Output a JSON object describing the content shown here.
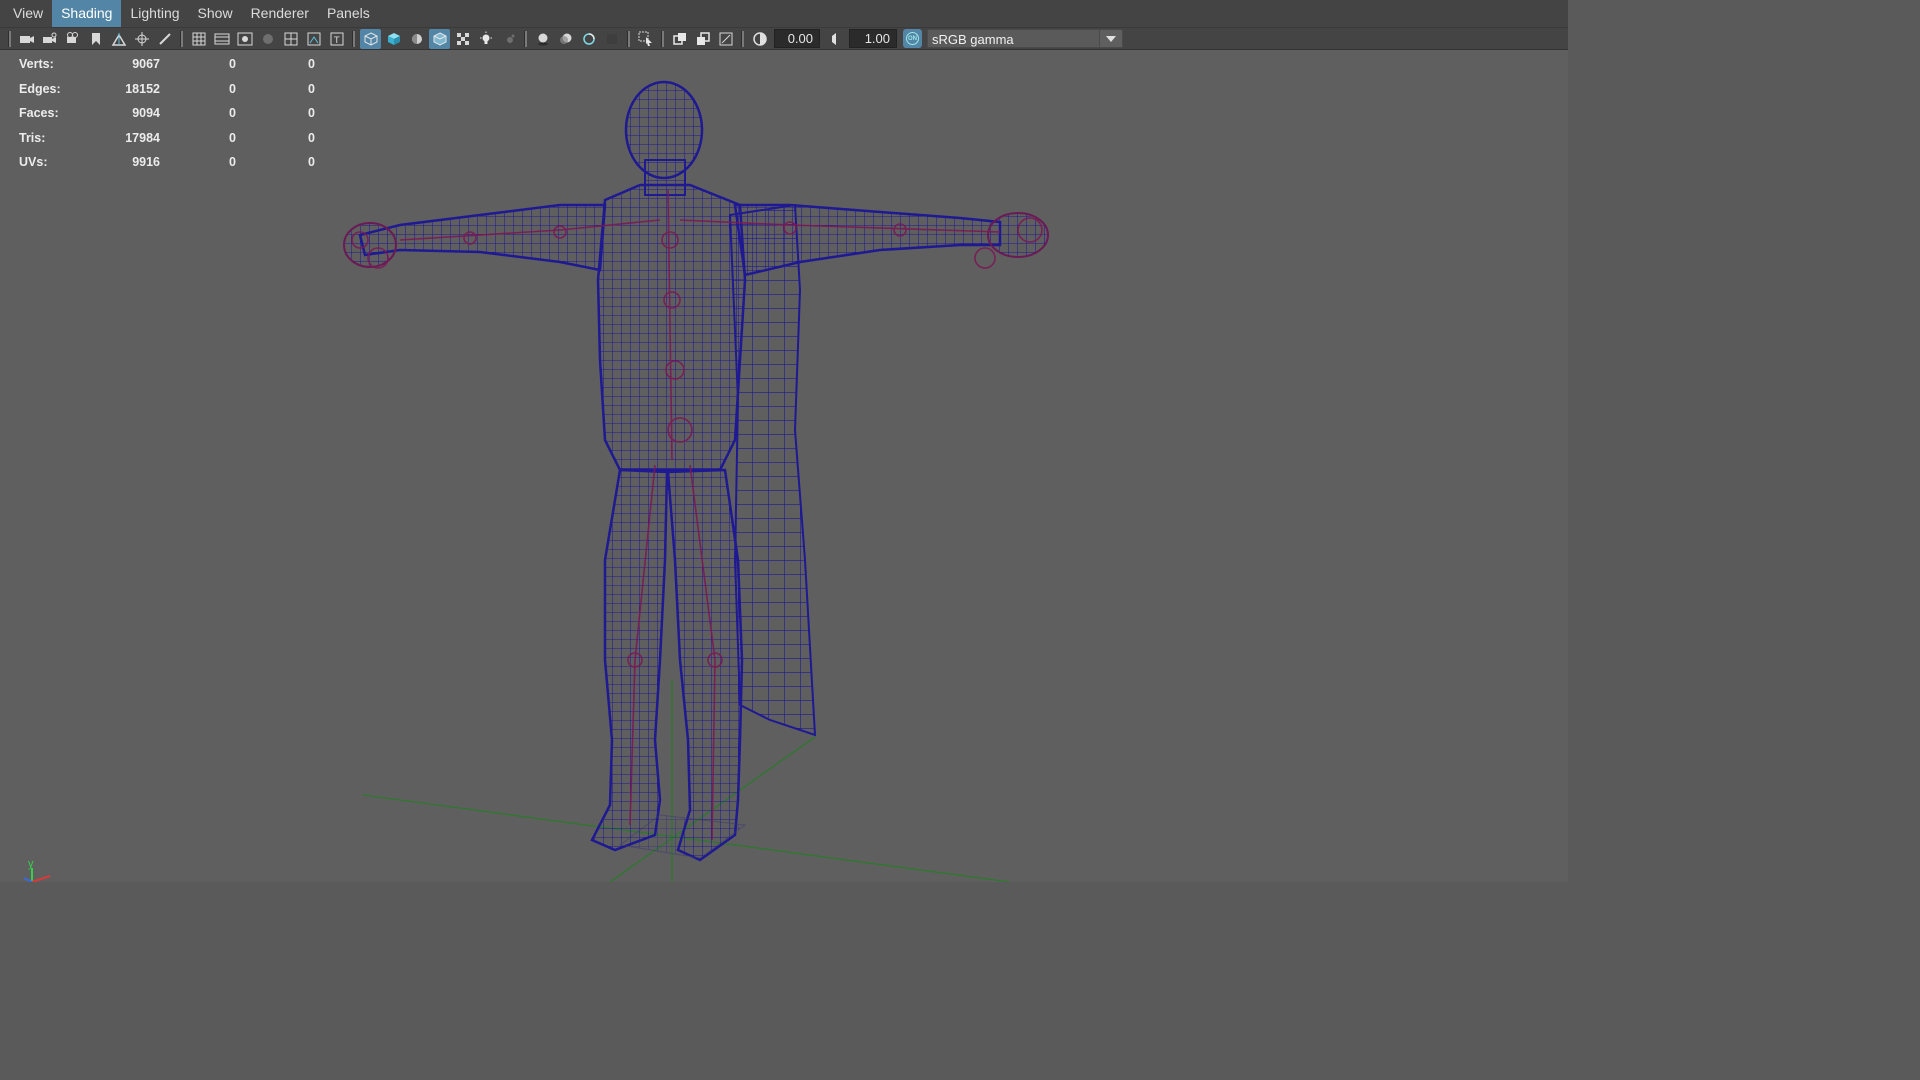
{
  "menubar": {
    "items": [
      {
        "label": "View",
        "active": false
      },
      {
        "label": "Shading",
        "active": true
      },
      {
        "label": "Lighting",
        "active": false
      },
      {
        "label": "Show",
        "active": false
      },
      {
        "label": "Renderer",
        "active": false
      },
      {
        "label": "Panels",
        "active": false
      }
    ]
  },
  "toolbar": {
    "exposure_value": "0.00",
    "gamma_value": "1.00",
    "color_management_badge": "ON",
    "color_space": "sRGB gamma",
    "accent_color": "#5285a6"
  },
  "hud": {
    "rows": [
      {
        "label": "Verts:",
        "v1": "9067",
        "v2": "0",
        "v3": "0"
      },
      {
        "label": "Edges:",
        "v1": "18152",
        "v2": "0",
        "v3": "0"
      },
      {
        "label": "Faces:",
        "v1": "9094",
        "v2": "0",
        "v3": "0"
      },
      {
        "label": "Tris:",
        "v1": "17984",
        "v2": "0",
        "v3": "0"
      },
      {
        "label": "UVs:",
        "v1": "9916",
        "v2": "0",
        "v3": "0"
      }
    ]
  },
  "viewport": {
    "axis_label_y": "y",
    "wireframe_color": "#1e1890",
    "joint_color": "#7a1a55",
    "grid_color": "#2a7a2a",
    "background_color": "#5f5f5f"
  }
}
